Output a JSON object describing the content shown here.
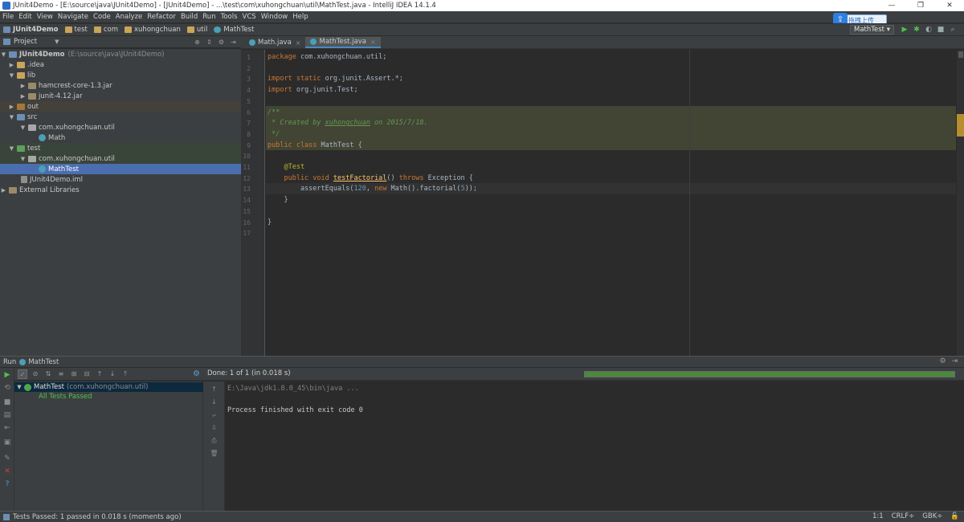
{
  "window": {
    "title": "JUnit4Demo - [E:\\source\\java\\JUnit4Demo] - [JUnit4Demo] - ...\\test\\com\\xuhongchuan\\util\\MathTest.java - IntelliJ IDEA 14.1.4",
    "minimize": "—",
    "maximize": "❐",
    "close": "✕"
  },
  "menu": [
    "File",
    "Edit",
    "View",
    "Navigate",
    "Code",
    "Analyze",
    "Refactor",
    "Build",
    "Run",
    "Tools",
    "VCS",
    "Window",
    "Help"
  ],
  "upload_badge": "拖拽上传",
  "breadcrumbs": [
    "JUnit4Demo",
    "test",
    "com",
    "xuhongchuan",
    "util",
    "MathTest"
  ],
  "run_config": "MathTest ▾",
  "project_panel": {
    "label": "Project",
    "tree": [
      {
        "label": "JUnit4Demo",
        "path": "(E:\\source\\java\\JUnit4Demo)",
        "arrow": "▼"
      },
      {
        "label": ".idea",
        "arrow": "▶"
      },
      {
        "label": "lib",
        "arrow": "▼"
      },
      {
        "label": "hamcrest-core-1.3.jar",
        "arrow": "▶"
      },
      {
        "label": "junit-4.12.jar",
        "arrow": "▶"
      },
      {
        "label": "out",
        "arrow": "▶"
      },
      {
        "label": "src",
        "arrow": "▼"
      },
      {
        "label": "com.xuhongchuan.util",
        "arrow": "▼"
      },
      {
        "label": "Math",
        "arrow": ""
      },
      {
        "label": "test",
        "arrow": "▼"
      },
      {
        "label": "com.xuhongchuan.util",
        "arrow": "▼"
      },
      {
        "label": "MathTest",
        "arrow": ""
      },
      {
        "label": "JUnit4Demo.iml",
        "arrow": ""
      },
      {
        "label": "External Libraries",
        "arrow": "▶"
      }
    ]
  },
  "editor_tabs": [
    {
      "label": "Math.java",
      "close": "×"
    },
    {
      "label": "MathTest.java",
      "close": "×"
    }
  ],
  "code_lines": [
    "1",
    "2",
    "3",
    "4",
    "5",
    "6",
    "7",
    "8",
    "9",
    "10",
    "11",
    "12",
    "13",
    "14",
    "15",
    "16",
    "17"
  ],
  "code": {
    "l1a": "package",
    "l1b": " com.xuhongchuan.util;",
    "l3a": "import static",
    "l3b": " org.junit.Assert.*;",
    "l4a": "import",
    "l4b": " org.junit.Test;",
    "l6": "/**",
    "l7a": " * Created by ",
    "l7b": "xuhongchuan",
    "l7c": " on 2015/7/18.",
    "l8": " */",
    "l9a": "public class",
    "l9b": " MathTest {",
    "l11": "    @Test",
    "l12a": "    public void ",
    "l12b": "testFactorial",
    "l12c": "() ",
    "l12d": "throws",
    "l12e": " Exception {",
    "l13a": "        assertEquals(",
    "l13b": "120",
    "l13c": ", ",
    "l13d": "new",
    "l13e": " Math().factorial(",
    "l13f": "5",
    "l13g": "));",
    "l14": "    }",
    "l16": "}"
  },
  "run_panel": {
    "tab_label": "Run",
    "config": "MathTest",
    "status": "Done: 1 of 1 (in 0.018 s)",
    "progress": 1.0,
    "test_root": "MathTest",
    "test_root_pkg": "(com.xuhongchuan.util)",
    "test_child": "All Tests Passed",
    "console_cmd": "E:\\Java\\jdk1.8.0_45\\bin\\java ...",
    "console_out": "Process finished with exit code 0"
  },
  "status_bar": {
    "message": "Tests Passed: 1 passed in 0.018 s (moments ago)",
    "position": "1:1",
    "line_sep": "CRLF÷",
    "encoding": "GBK÷"
  },
  "colors": {
    "background": "#2b2b2b",
    "panel": "#3c3f41",
    "selection": "#4b6eaf",
    "keyword": "#cc7832",
    "comment": "#629755",
    "pass_green": "#4fc04f"
  }
}
